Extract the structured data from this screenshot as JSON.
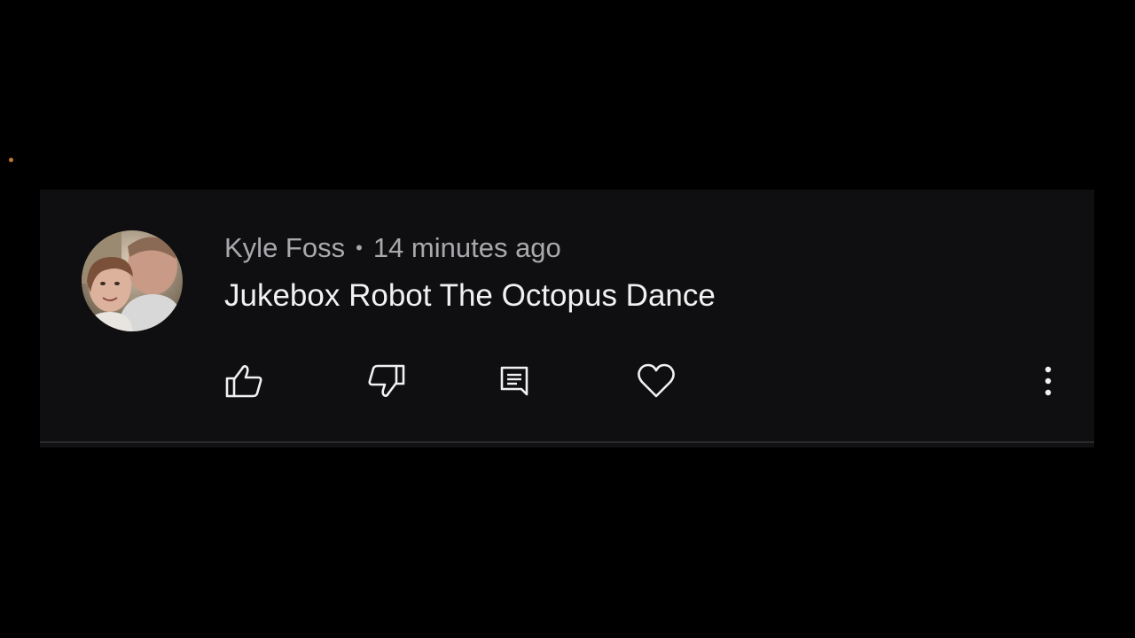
{
  "comment": {
    "author": "Kyle Foss",
    "separator": "•",
    "timestamp": "14 minutes ago",
    "text": "Jukebox Robot The Octopus Dance"
  },
  "actions": {
    "like_icon": "thumbs-up-icon",
    "dislike_icon": "thumbs-down-icon",
    "reply_icon": "comment-icon",
    "heart_icon": "heart-icon",
    "more_icon": "more-vertical-icon"
  },
  "colors": {
    "background": "#000000",
    "card": "#0f0f11",
    "meta_text": "#a9a9ad",
    "body_text": "#f1f1f1",
    "icon": "#f1f1f1"
  }
}
